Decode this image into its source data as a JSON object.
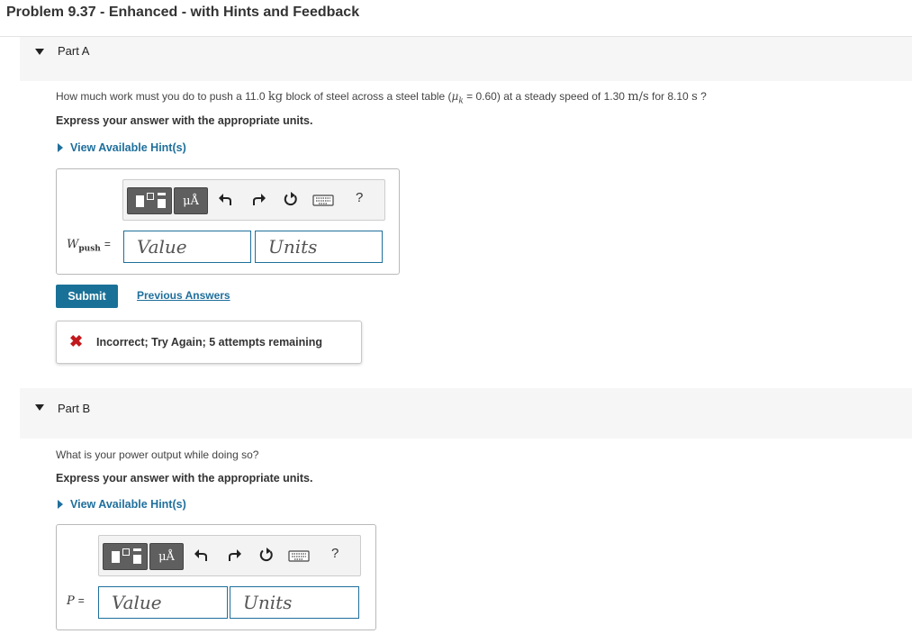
{
  "problem_title": "Problem 9.37 - Enhanced - with Hints and Feedback",
  "partA": {
    "title": "Part A",
    "question": {
      "t1": "How much work must you do to push a 11.0 ",
      "u1": "kg",
      "t2": " block of steel across a steel table (",
      "mu": "μ",
      "mu_sub": "k",
      "t3": " = 0.60) at a steady speed of 1.30 ",
      "u2": "m/s",
      "t4": " for 8.10 ",
      "u3": "s",
      "t5": " ?"
    },
    "instruction": "Express your answer with the appropriate units.",
    "hint_link": "View Available Hint(s)",
    "unit_button": "μÅ",
    "help_button": "?",
    "var_main": "W",
    "var_sub": "push",
    "equals": "=",
    "value_placeholder": "Value",
    "units_placeholder": "Units",
    "submit_label": "Submit",
    "previous_answers": "Previous Answers",
    "feedback_icon": "✖",
    "feedback_text": "Incorrect; Try Again; 5 attempts remaining"
  },
  "partB": {
    "title": "Part B",
    "question": "What is your power output while doing so?",
    "instruction": "Express your answer with the appropriate units.",
    "hint_link": "View Available Hint(s)",
    "unit_button": "μÅ",
    "help_button": "?",
    "var_main": "P",
    "equals": "=",
    "value_placeholder": "Value",
    "units_placeholder": "Units"
  },
  "colors": {
    "accent": "#1a7197",
    "link": "#1f6f9c",
    "error": "#c2191c",
    "header_bg": "#f6f6f6"
  },
  "icons": [
    "chevron-down-icon",
    "template-icon",
    "undo-icon",
    "redo-icon",
    "reset-icon",
    "keyboard-icon",
    "help-icon",
    "error-x-icon"
  ]
}
